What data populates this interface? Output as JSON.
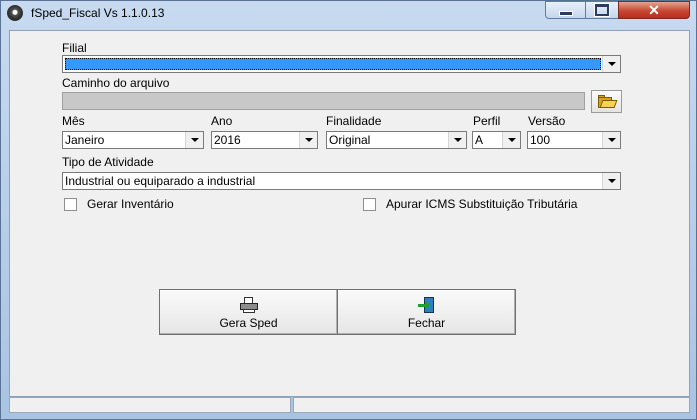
{
  "window": {
    "title": "fSped_Fiscal Vs 1.1.0.13"
  },
  "form": {
    "filial": {
      "label": "Filial",
      "value": ""
    },
    "caminho": {
      "label": "Caminho do arquivo",
      "value": ""
    },
    "mes": {
      "label": "Mês",
      "value": "Janeiro"
    },
    "ano": {
      "label": "Ano",
      "value": "2016"
    },
    "finalidade": {
      "label": "Finalidade",
      "value": "Original"
    },
    "perfil": {
      "label": "Perfil",
      "value": "A"
    },
    "versao": {
      "label": "Versão",
      "value": "100"
    },
    "tipo_atividade": {
      "label": "Tipo de Atividade",
      "value": "Industrial ou equiparado a industrial"
    },
    "gerar_inventario": {
      "label": "Gerar Inventário",
      "checked": false
    },
    "apurar_icms": {
      "label": "Apurar ICMS Substituição Tributária",
      "checked": false
    }
  },
  "buttons": {
    "gera_sped": {
      "label": "Gera Sped",
      "icon": "printer-icon"
    },
    "fechar": {
      "label": "Fechar",
      "icon": "exit-door-icon"
    }
  },
  "colors": {
    "selection": "#3399ff",
    "close_button": "#c74734"
  }
}
